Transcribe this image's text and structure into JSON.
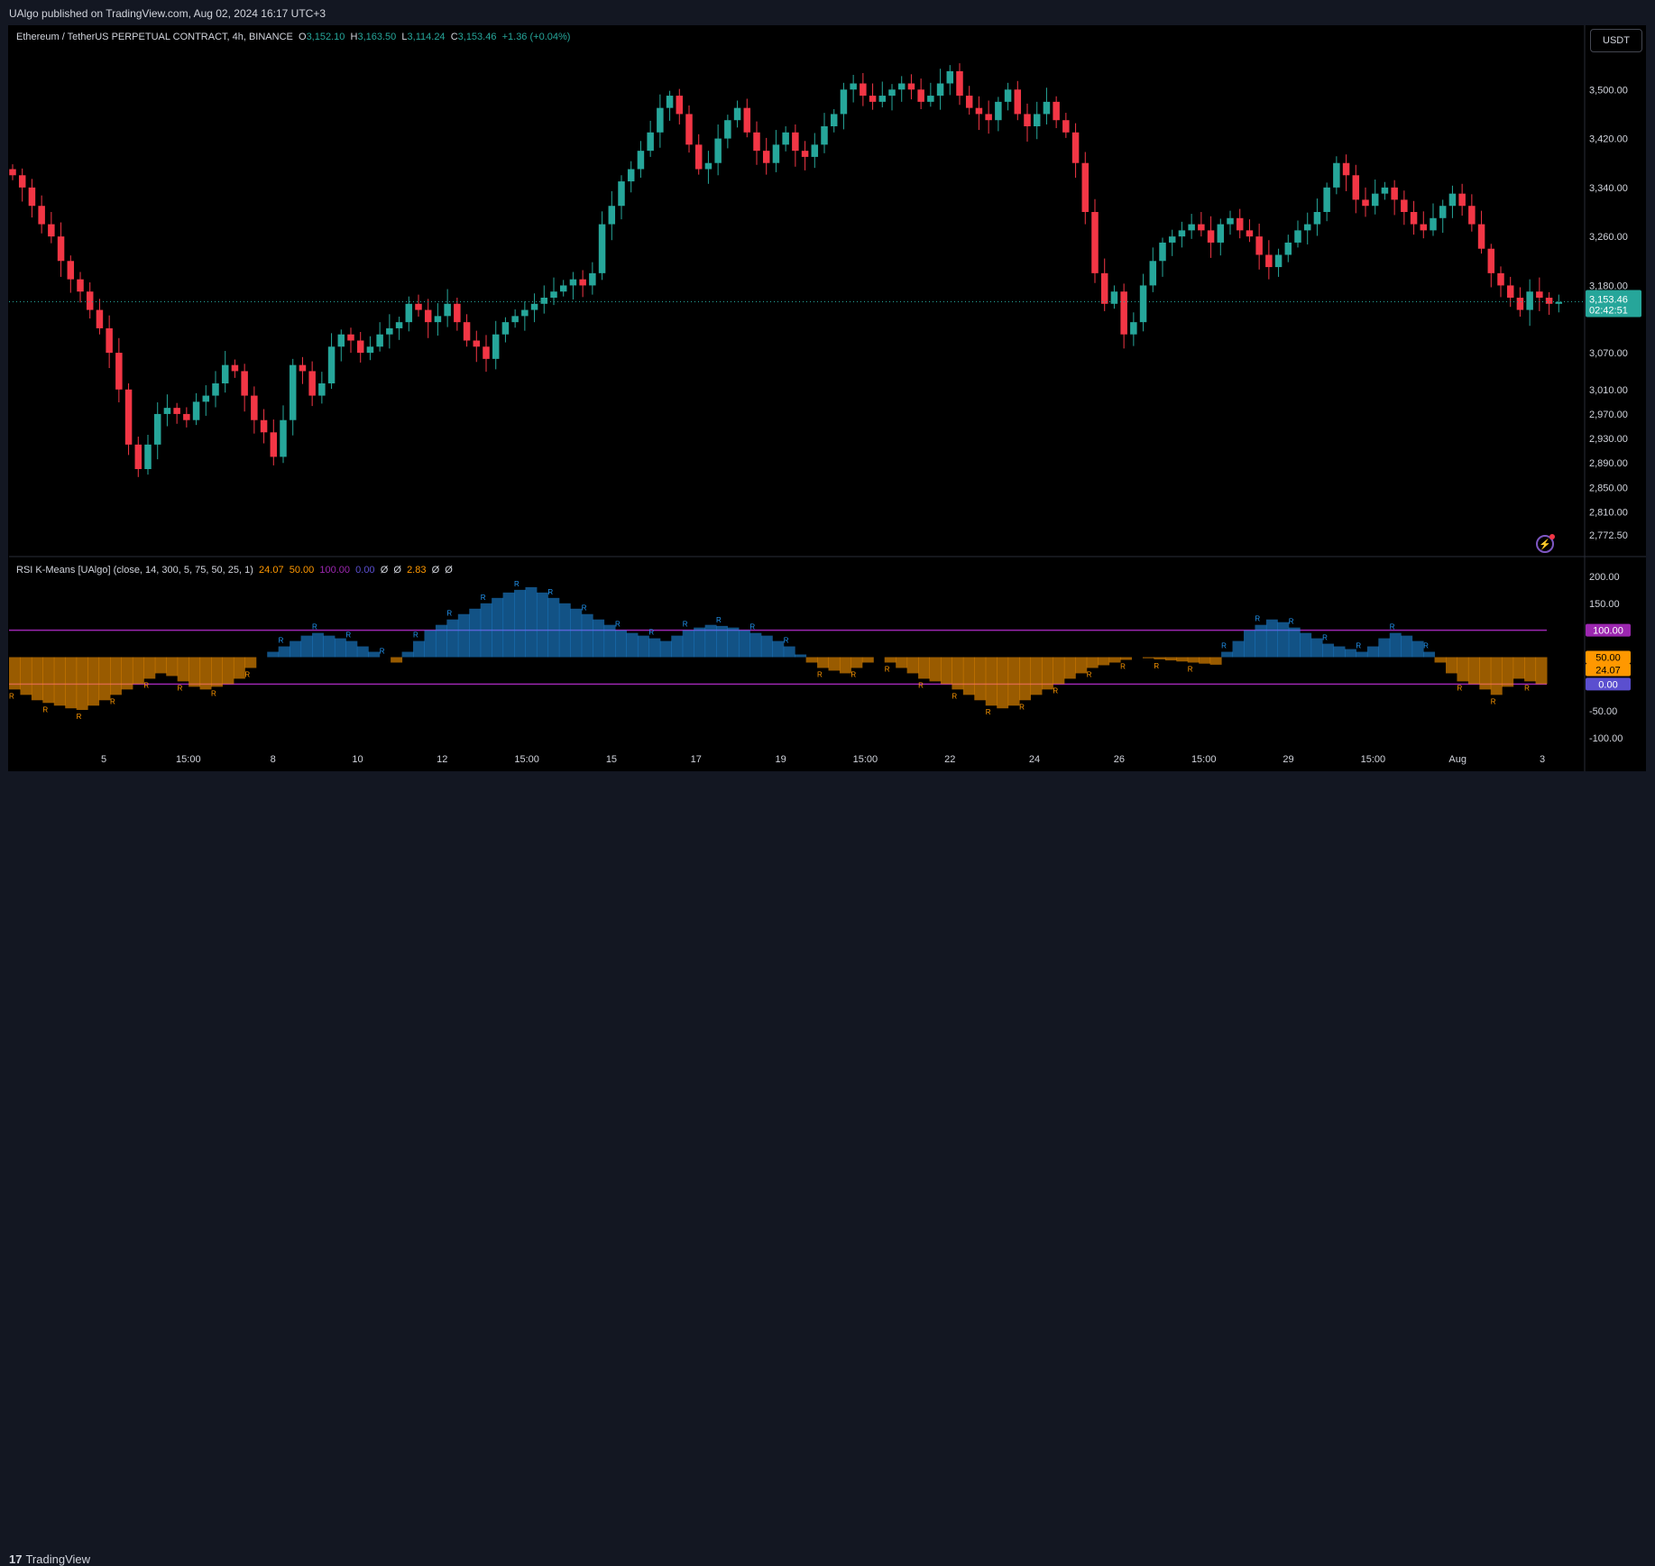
{
  "header": {
    "published": "UAlgo published on TradingView.com, Aug 02, 2024 16:17 UTC+3"
  },
  "footer": {
    "brand": "TradingView",
    "logo_glyph": "17"
  },
  "toolbar": {
    "currency": "USDT"
  },
  "colors": {
    "up": "#26a69a",
    "down": "#f23645",
    "bull_zone": "#2196f3",
    "bear_zone": "#ff9800",
    "purple": "#9c27b0",
    "neutral": "#5b4fcf"
  },
  "chart_data": [
    {
      "type": "candlestick",
      "legend": {
        "symbol": "Ethereum / TetherUS PERPETUAL CONTRACT, 4h, BINANCE",
        "o_label": "O",
        "o": "3,152.10",
        "h_label": "H",
        "h": "3,163.50",
        "l_label": "L",
        "l": "3,114.24",
        "c_label": "C",
        "c": "3,153.46",
        "change": "+1.36 (+0.04%)"
      },
      "ylim": [
        2740,
        3580
      ],
      "y_ticks": [
        "3,500.00",
        "3,420.00",
        "3,340.00",
        "3,260.00",
        "3,180.00",
        "3,070.00",
        "3,010.00",
        "2,970.00",
        "2,930.00",
        "2,890.00",
        "2,850.00",
        "2,810.00",
        "2,772.50"
      ],
      "y_tick_values": [
        3500,
        3420,
        3340,
        3260,
        3180,
        3070,
        3010,
        2970,
        2930,
        2890,
        2850,
        2810,
        2772.5
      ],
      "last_price": {
        "value": 3153.46,
        "label": "3,153.46",
        "countdown": "02:42:51"
      },
      "x_ticks": [
        "5",
        "15:00",
        "8",
        "10",
        "12",
        "15:00",
        "15",
        "17",
        "19",
        "15:00",
        "22",
        "24",
        "26",
        "15:00",
        "29",
        "15:00",
        "Aug",
        "3"
      ],
      "close_path": [
        3360,
        3340,
        3310,
        3280,
        3260,
        3220,
        3190,
        3170,
        3140,
        3110,
        3070,
        3010,
        2920,
        2880,
        2920,
        2970,
        2980,
        2970,
        2960,
        2990,
        3000,
        3020,
        3050,
        3040,
        3000,
        2960,
        2940,
        2900,
        2960,
        3050,
        3040,
        3000,
        3020,
        3080,
        3100,
        3090,
        3070,
        3080,
        3100,
        3110,
        3120,
        3150,
        3140,
        3120,
        3130,
        3150,
        3120,
        3090,
        3080,
        3060,
        3100,
        3120,
        3130,
        3140,
        3150,
        3160,
        3170,
        3180,
        3190,
        3180,
        3200,
        3280,
        3310,
        3350,
        3370,
        3400,
        3430,
        3470,
        3490,
        3460,
        3410,
        3370,
        3380,
        3420,
        3450,
        3470,
        3430,
        3400,
        3380,
        3410,
        3430,
        3400,
        3390,
        3410,
        3440,
        3460,
        3500,
        3510,
        3490,
        3480,
        3490,
        3500,
        3510,
        3500,
        3480,
        3490,
        3510,
        3530,
        3490,
        3470,
        3460,
        3450,
        3480,
        3500,
        3460,
        3440,
        3460,
        3480,
        3450,
        3430,
        3380,
        3300,
        3200,
        3150,
        3170,
        3100,
        3120,
        3180,
        3220,
        3250,
        3260,
        3270,
        3280,
        3270,
        3250,
        3280,
        3290,
        3270,
        3260,
        3230,
        3210,
        3230,
        3250,
        3270,
        3280,
        3300,
        3340,
        3380,
        3360,
        3320,
        3310,
        3330,
        3340,
        3320,
        3300,
        3280,
        3270,
        3290,
        3310,
        3330,
        3310,
        3280,
        3240,
        3200,
        3180,
        3160,
        3140,
        3170,
        3160,
        3150,
        3153
      ]
    },
    {
      "type": "area",
      "legend": {
        "name": "RSI K-Means [UAlgo] (close, 14, 300, 5, 75, 50, 25, 1)",
        "v1": "24.07",
        "v2": "50.00",
        "v3": "100.00",
        "v4": "0.00",
        "v5": "Ø",
        "v6": "Ø",
        "v7": "2.83",
        "v8": "Ø",
        "v9": "Ø"
      },
      "ylim": [
        -120,
        215
      ],
      "y_ticks": [
        "200.00",
        "150.00",
        "-50.00",
        "-100.00"
      ],
      "y_tick_values": [
        200,
        150,
        -50,
        -100
      ],
      "levels": [
        {
          "value": 100,
          "label": "100.00"
        },
        {
          "value": 50,
          "label": "50.00"
        },
        {
          "value": 24.07,
          "label": "24.07"
        },
        {
          "value": 0,
          "label": "0.00"
        }
      ],
      "marker_letter": "R",
      "osc_path": [
        -10,
        -20,
        -30,
        -35,
        -40,
        -45,
        -48,
        -40,
        -30,
        -20,
        -10,
        0,
        10,
        20,
        15,
        5,
        -5,
        -10,
        -5,
        0,
        10,
        30,
        50,
        60,
        70,
        80,
        90,
        95,
        90,
        85,
        80,
        70,
        60,
        50,
        40,
        60,
        80,
        100,
        110,
        120,
        130,
        140,
        150,
        160,
        170,
        175,
        180,
        170,
        160,
        150,
        140,
        130,
        120,
        110,
        100,
        95,
        90,
        85,
        80,
        90,
        100,
        105,
        110,
        108,
        105,
        100,
        95,
        90,
        80,
        70,
        55,
        40,
        30,
        25,
        20,
        30,
        40,
        50,
        40,
        30,
        20,
        10,
        5,
        0,
        -10,
        -20,
        -30,
        -40,
        -45,
        -40,
        -30,
        -20,
        -10,
        0,
        10,
        20,
        30,
        35,
        40,
        45,
        50,
        48,
        46,
        44,
        42,
        40,
        38,
        36,
        60,
        80,
        100,
        110,
        120,
        115,
        105,
        95,
        85,
        75,
        70,
        65,
        60,
        70,
        85,
        95,
        90,
        80,
        60,
        40,
        20,
        5,
        0,
        -10,
        -20,
        -5,
        10,
        5,
        0
      ]
    }
  ]
}
